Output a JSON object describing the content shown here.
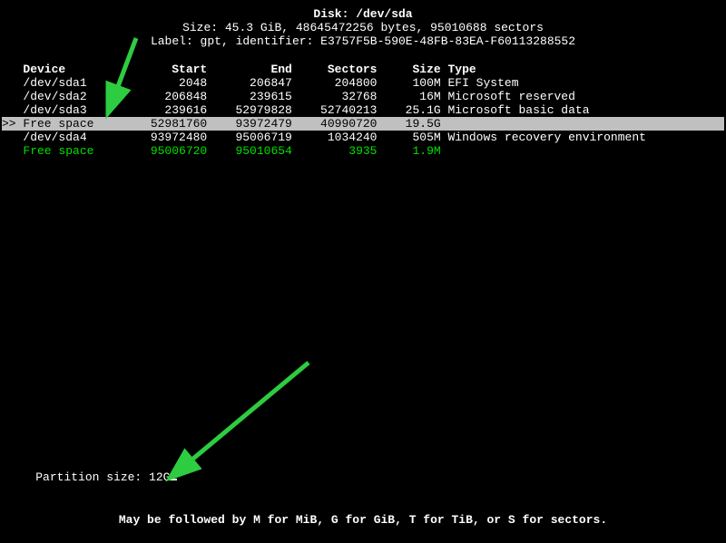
{
  "header": {
    "disk_label": "Disk: /dev/sda",
    "size_line": "Size: 45.3 GiB, 48645472256 bytes, 95010688 sectors",
    "label_line": "Label: gpt, identifier: E3757F5B-590E-48FB-83EA-F60113288552"
  },
  "columns": {
    "device": "Device",
    "start": "Start",
    "end": "End",
    "sectors": "Sectors",
    "size": "Size",
    "type": "Type"
  },
  "partitions": [
    {
      "device": "/dev/sda1",
      "start": "2048",
      "end": "206847",
      "sectors": "204800",
      "size": "100M",
      "type": "EFI System",
      "free": false,
      "selected": false
    },
    {
      "device": "/dev/sda2",
      "start": "206848",
      "end": "239615",
      "sectors": "32768",
      "size": "16M",
      "type": "Microsoft reserved",
      "free": false,
      "selected": false
    },
    {
      "device": "/dev/sda3",
      "start": "239616",
      "end": "52979828",
      "sectors": "52740213",
      "size": "25.1G",
      "type": "Microsoft basic data",
      "free": false,
      "selected": false
    },
    {
      "device": "Free space",
      "start": "52981760",
      "end": "93972479",
      "sectors": "40990720",
      "size": "19.5G",
      "type": "",
      "free": true,
      "selected": true
    },
    {
      "device": "/dev/sda4",
      "start": "93972480",
      "end": "95006719",
      "sectors": "1034240",
      "size": "505M",
      "type": "Windows recovery environment",
      "free": false,
      "selected": false
    },
    {
      "device": "Free space",
      "start": "95006720",
      "end": "95010654",
      "sectors": "3935",
      "size": "1.9M",
      "type": "",
      "free": true,
      "selected": false
    }
  ],
  "prompt": {
    "label": "Partition size: ",
    "value": "12G"
  },
  "hint": "May be followed by M for MiB, G for GiB, T for TiB, or S for sectors.",
  "colors": {
    "green": "#00e000",
    "selected_bg": "#c0c0c0"
  }
}
